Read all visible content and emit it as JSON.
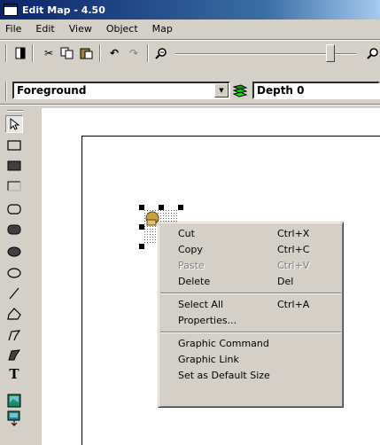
{
  "window": {
    "title": "Edit Map - 4.50"
  },
  "menubar": [
    "File",
    "Edit",
    "View",
    "Object",
    "Map"
  ],
  "toolbar": {
    "layer_select": "Foreground",
    "depth_select": "Depth 0"
  },
  "context_menu": {
    "groups": [
      [
        {
          "label": "Cut",
          "shortcut": "Ctrl+X",
          "enabled": true
        },
        {
          "label": "Copy",
          "shortcut": "Ctrl+C",
          "enabled": true
        },
        {
          "label": "Paste",
          "shortcut": "Ctrl+V",
          "enabled": false
        },
        {
          "label": "Delete",
          "shortcut": "Del",
          "enabled": true
        }
      ],
      [
        {
          "label": "Select All",
          "shortcut": "Ctrl+A",
          "enabled": true
        },
        {
          "label": "Properties...",
          "shortcut": "",
          "enabled": true
        }
      ],
      [
        {
          "label": "Graphic Command",
          "shortcut": "",
          "enabled": true
        },
        {
          "label": "Graphic Link",
          "shortcut": "",
          "enabled": true
        },
        {
          "label": "Set as Default Size",
          "shortcut": "",
          "enabled": true
        }
      ]
    ]
  },
  "tools": [
    "pointer-tool-icon",
    "rectangle-tool-icon",
    "filled-rectangle-tool-icon",
    "open-rectangle-tool-icon",
    "rounded-rectangle-tool-icon",
    "filled-rounded-rectangle-tool-icon",
    "filled-ellipse-tool-icon",
    "ellipse-tool-icon",
    "line-tool-icon",
    "polygon-tool-icon",
    "polyline-tool-icon",
    "filled-polyline-tool-icon",
    "text-tool-icon",
    "image-tool-icon",
    "link-tool-icon"
  ]
}
